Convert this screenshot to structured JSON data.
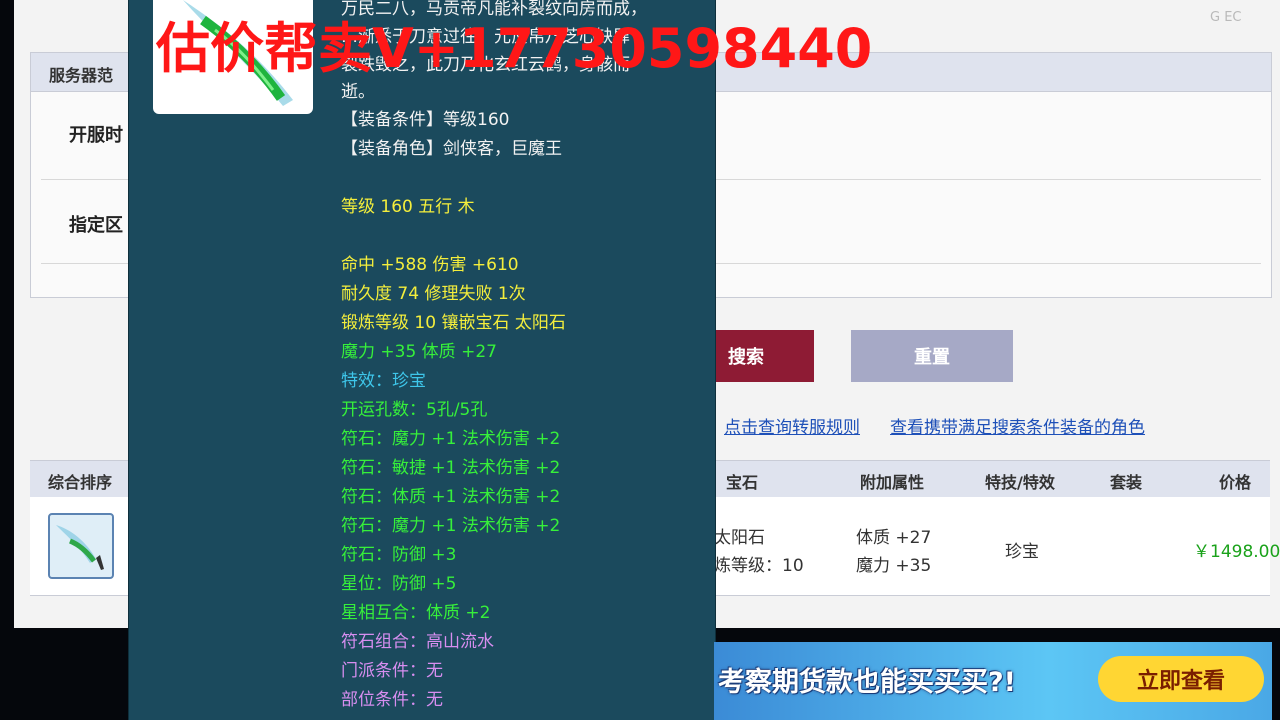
{
  "watermark": "估价帮卖V+17730598440",
  "top_logo_text": "G EC",
  "filter_panel": {
    "header": "服务器范",
    "rows": [
      {
        "label": "开服时"
      },
      {
        "label": "指定区"
      }
    ]
  },
  "buttons": {
    "search": "搜索",
    "reset": "重置"
  },
  "links": {
    "transfer_rules": "点击查询转服规则",
    "view_roles": "查看携带满足搜索条件装备的角色"
  },
  "results": {
    "columns": {
      "sort": "综合排序",
      "gem": "宝石",
      "extra_attr": "附加属性",
      "skill": "特技/特效",
      "set": "套装",
      "price": "价格"
    },
    "row": {
      "gem_line1": "太阳石",
      "gem_line2": "炼等级：10",
      "attr_line1": "体质 +27",
      "attr_line2": "魔力 +35",
      "skill": "珍宝",
      "price": "￥1498.00"
    }
  },
  "tooltip": {
    "desc_lines": [
      "万民二八，马贡帝凡能补裂纹向房而成，",
      "…渐悉于刀意过往，元反帛乃芝心缺肆",
      "裂跌毁之，此刀乃化玄红云鹤，身骸而",
      "逝。"
    ],
    "lines": [
      {
        "text": "【装备条件】等级160",
        "color": "white"
      },
      {
        "text": "【装备角色】剑侠客，巨魔王",
        "color": "white"
      },
      {
        "text": "等级 160 五行 木",
        "color": "yellow"
      },
      {
        "text": "命中 +588 伤害 +610",
        "color": "yellow"
      },
      {
        "text": "耐久度 74 修理失败 1次",
        "color": "yellow"
      },
      {
        "text": "锻炼等级 10 镶嵌宝石 太阳石",
        "color": "yellow"
      },
      {
        "text": "魔力 +35 体质 +27",
        "color": "green"
      },
      {
        "text": "特效：珍宝",
        "color": "cyan"
      },
      {
        "text": "开运孔数：5孔/5孔",
        "color": "green"
      },
      {
        "text": "符石：魔力 +1 法术伤害 +2",
        "color": "green"
      },
      {
        "text": "符石：敏捷 +1 法术伤害 +2",
        "color": "green"
      },
      {
        "text": "符石：体质 +1 法术伤害 +2",
        "color": "green"
      },
      {
        "text": "符石：魔力 +1 法术伤害 +2",
        "color": "green"
      },
      {
        "text": "符石：防御 +3",
        "color": "green"
      },
      {
        "text": "星位：防御 +5",
        "color": "green"
      },
      {
        "text": "星相互合：体质 +2",
        "color": "green"
      },
      {
        "text": "符石组合：高山流水",
        "color": "purple"
      },
      {
        "text": "门派条件：无",
        "color": "purple"
      },
      {
        "text": "部位条件：无",
        "color": "purple"
      }
    ]
  },
  "ad": {
    "text": "考察期货款也能买买买?!",
    "button": "立即查看"
  }
}
